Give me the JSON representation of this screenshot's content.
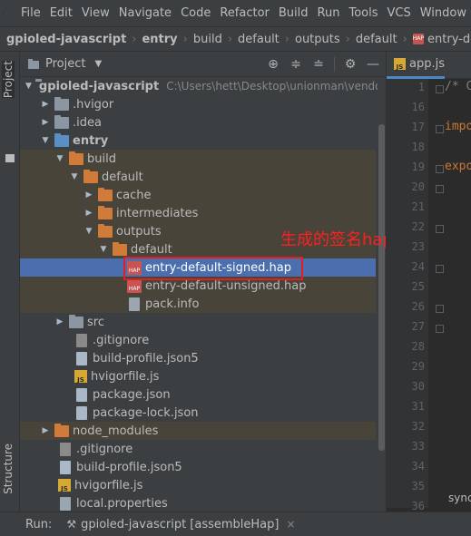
{
  "menu": [
    "File",
    "Edit",
    "View",
    "Navigate",
    "Code",
    "Refactor",
    "Build",
    "Run",
    "Tools",
    "VCS",
    "Window"
  ],
  "breadcrumbs": [
    "gpioled-javascript",
    "entry",
    "build",
    "default",
    "outputs",
    "default",
    "entry-default-signe"
  ],
  "left_strip": {
    "project": "Project",
    "structure": "Structure"
  },
  "project_panel": {
    "title": "Project"
  },
  "tree": {
    "root_name": "gpioled-javascript",
    "root_path": "C:\\Users\\hett\\Desktop\\unionman\\vendo",
    "hvigor": ".hvigor",
    "idea": ".idea",
    "entry": "entry",
    "build": "build",
    "default": "default",
    "cache": "cache",
    "intermediates": "intermediates",
    "outputs": "outputs",
    "default2": "default",
    "signed_hap": "entry-default-signed.hap",
    "unsigned_hap": "entry-default-unsigned.hap",
    "pack_info": "pack.info",
    "src": "src",
    "entry_gitignore": ".gitignore",
    "entry_build_profile": "build-profile.json5",
    "entry_hvigorfile": "hvigorfile.js",
    "entry_package": "package.json",
    "entry_package_lock": "package-lock.json",
    "node_modules": "node_modules",
    "root_gitignore": ".gitignore",
    "root_build_profile": "build-profile.json5",
    "root_hvigorfile": "hvigorfile.js",
    "local_properties": "local.properties"
  },
  "annotation": "生成的签名hap",
  "editor": {
    "tab": "app.js",
    "line_numbers": [
      "1",
      "16",
      "17",
      "18",
      "19",
      "20",
      "21",
      "22",
      "23",
      "24",
      "25",
      "26",
      "27",
      "28",
      "29",
      "30",
      "31",
      "32",
      "33",
      "34",
      "35",
      "36"
    ],
    "code_comment": "/* C",
    "code_import": "impo",
    "code_export": "expo",
    "status": "sync"
  },
  "run_bar": {
    "label": "Run:",
    "config": "gpioled-javascript [assembleHap]"
  },
  "icons": {
    "js_badge": "JS",
    "hap_badge": "HAP"
  },
  "colors": {
    "selection": "#4b6eaf",
    "annotation": "#ff1f1f",
    "folder_orange": "#d07b3a"
  }
}
